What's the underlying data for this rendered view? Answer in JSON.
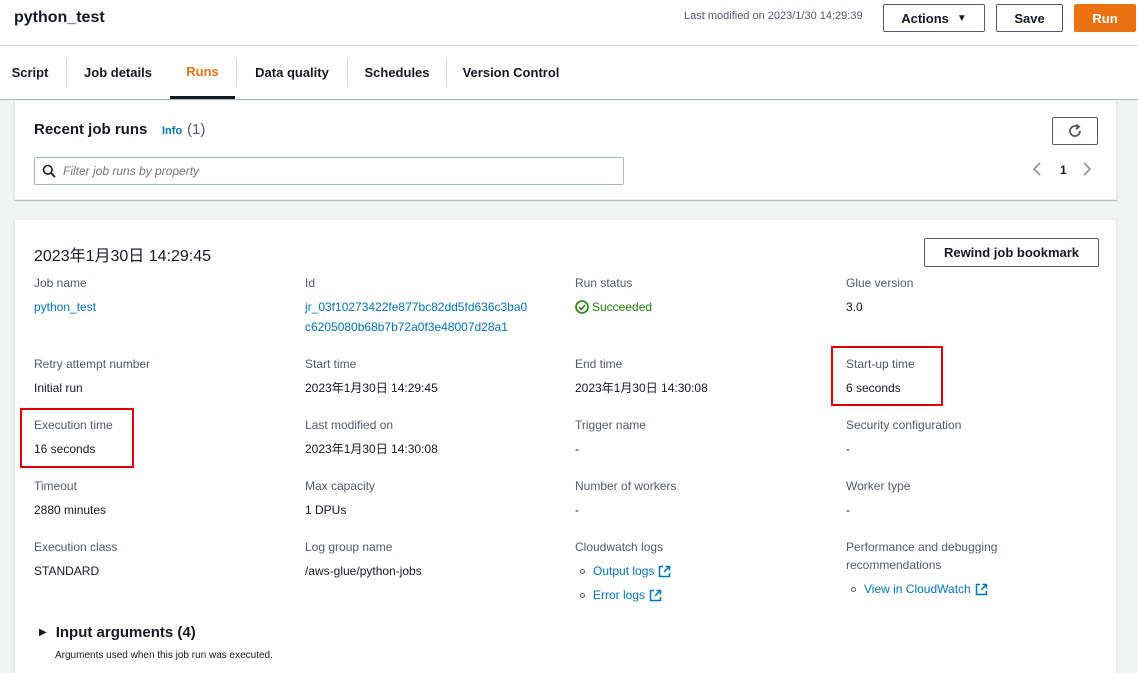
{
  "header": {
    "job_title": "python_test",
    "last_modified": "Last modified on 2023/1/30 14:29:39",
    "actions_label": "Actions",
    "save_label": "Save",
    "run_label": "Run"
  },
  "tabs": [
    {
      "label": "Script"
    },
    {
      "label": "Job details"
    },
    {
      "label": "Runs"
    },
    {
      "label": "Data quality"
    },
    {
      "label": "Schedules"
    },
    {
      "label": "Version Control"
    }
  ],
  "recent_runs": {
    "title": "Recent job runs",
    "info_label": "Info",
    "count": "(1)",
    "filter_placeholder": "Filter job runs by property",
    "page_number": "1"
  },
  "run": {
    "title": "2023年1月30日 14:29:45",
    "rewind_label": "Rewind job bookmark",
    "job_name_label": "Job name",
    "job_name": "python_test",
    "id_label": "Id",
    "id_line1": "jr_03f10273422fe877bc82dd5fd636c3ba0",
    "id_line2": "c6205080b68b7b72a0f3e48007d28a1",
    "run_status_label": "Run status",
    "run_status": "Succeeded",
    "glue_version_label": "Glue version",
    "glue_version": "3.0",
    "retry_label": "Retry attempt number",
    "retry": "Initial run",
    "start_time_label": "Start time",
    "start_time": "2023年1月30日 14:29:45",
    "end_time_label": "End time",
    "end_time": "2023年1月30日 14:30:08",
    "startup_label": "Start-up time",
    "startup": "6 seconds",
    "execution_label": "Execution time",
    "execution": "16 seconds",
    "last_modified_label": "Last modified on",
    "last_modified": "2023年1月30日 14:30:08",
    "trigger_label": "Trigger name",
    "trigger": "-",
    "security_label": "Security configuration",
    "security": "-",
    "timeout_label": "Timeout",
    "timeout": "2880 minutes",
    "max_capacity_label": "Max capacity",
    "max_capacity": "1 DPUs",
    "workers_label": "Number of workers",
    "workers": "-",
    "worker_type_label": "Worker type",
    "worker_type": "-",
    "exec_class_label": "Execution class",
    "exec_class": "STANDARD",
    "log_group_label": "Log group name",
    "log_group": "/aws-glue/python-jobs",
    "cloudwatch_label": "Cloudwatch logs",
    "output_logs": "Output logs",
    "error_logs": "Error logs",
    "perf_label_line1": "Performance and debugging",
    "perf_label_line2": "recommendations",
    "view_cloudwatch": "View in CloudWatch"
  },
  "input_args": {
    "title": "Input arguments (4)",
    "description": "Arguments used when this job run was executed."
  },
  "colors": {
    "accent": "#ec7211",
    "link": "#0073bb",
    "success": "#1d8102",
    "highlight": "#e00000"
  }
}
